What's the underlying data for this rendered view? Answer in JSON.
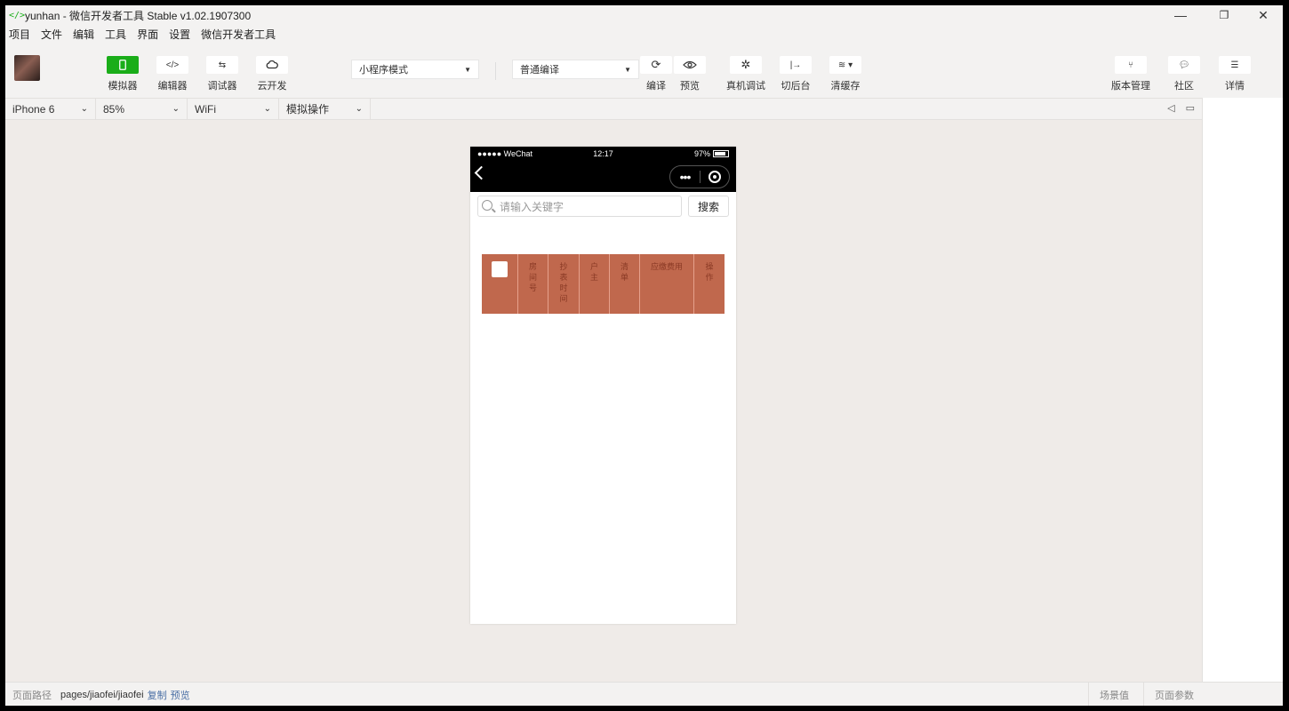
{
  "window": {
    "title": "yunhan - 微信开发者工具 Stable v1.02.1907300",
    "controls": [
      "—",
      "❐",
      "✕"
    ]
  },
  "menu": [
    "项目",
    "文件",
    "编辑",
    "工具",
    "界面",
    "设置",
    "微信开发者工具"
  ],
  "toolbar": {
    "simulator": "模拟器",
    "editor": "编辑器",
    "debugger": "调试器",
    "cloud": "云开发",
    "mode_select": "小程序模式",
    "compile_select": "普通编译",
    "compile": "编译",
    "preview": "预览",
    "remote_debug": "真机调试",
    "background": "切后台",
    "clear_cache": "清缓存",
    "version": "版本管理",
    "community": "社区",
    "details": "详情"
  },
  "device_bar": {
    "device": "iPhone 6",
    "zoom": "85%",
    "network": "WiFi",
    "operation": "模拟操作"
  },
  "phone": {
    "carrier": "●●●●● WeChat",
    "time": "12:17",
    "battery": "97%",
    "capsule_dots": "•••",
    "search_placeholder": "请输入关键字",
    "search_button": "搜索",
    "table_headers": [
      "房间号",
      "抄表时间",
      "户主",
      "清单",
      "应缴费用",
      "操作"
    ]
  },
  "status_bar": {
    "path_label": "页面路径",
    "path": "pages/jiaofei/jiaofei",
    "copy": "复制",
    "preview": "预览",
    "scene": "场景值",
    "params": "页面参数"
  },
  "colors": {
    "accent": "#1aad19",
    "table_header_bg": "#c0684d",
    "nav_bg": "#000000"
  }
}
